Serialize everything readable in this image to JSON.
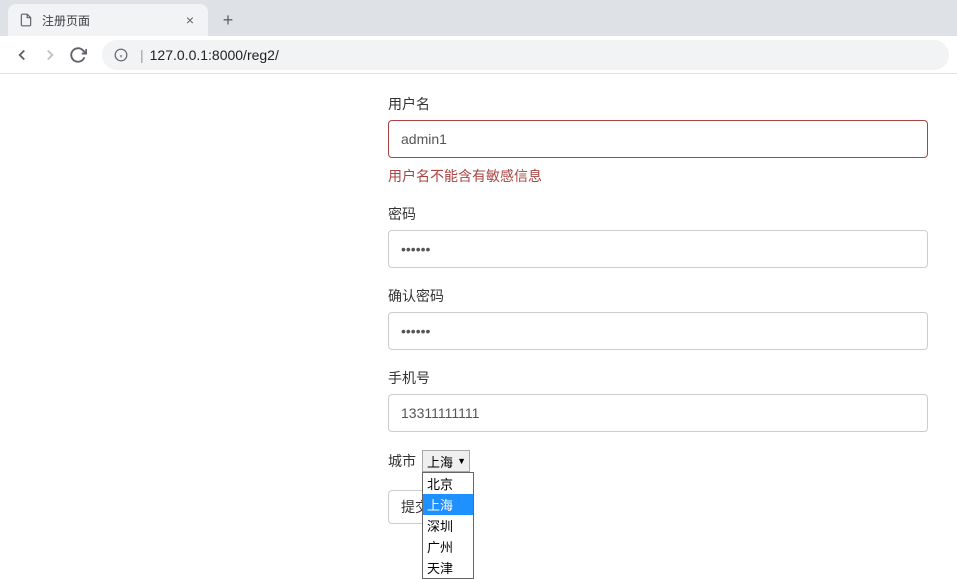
{
  "browser": {
    "tab_title": "注册页面",
    "url": "127.0.0.1:8000/reg2/"
  },
  "form": {
    "username": {
      "label": "用户名",
      "value": "admin1",
      "error": "用户名不能含有敏感信息"
    },
    "password": {
      "label": "密码",
      "value": "••••••"
    },
    "confirm_password": {
      "label": "确认密码",
      "value": "••••••"
    },
    "phone": {
      "label": "手机号",
      "value": "13311111111"
    },
    "city": {
      "label": "城市",
      "selected": "上海",
      "options": [
        "北京",
        "上海",
        "深圳",
        "广州",
        "天津"
      ]
    },
    "submit_label": "提交"
  }
}
